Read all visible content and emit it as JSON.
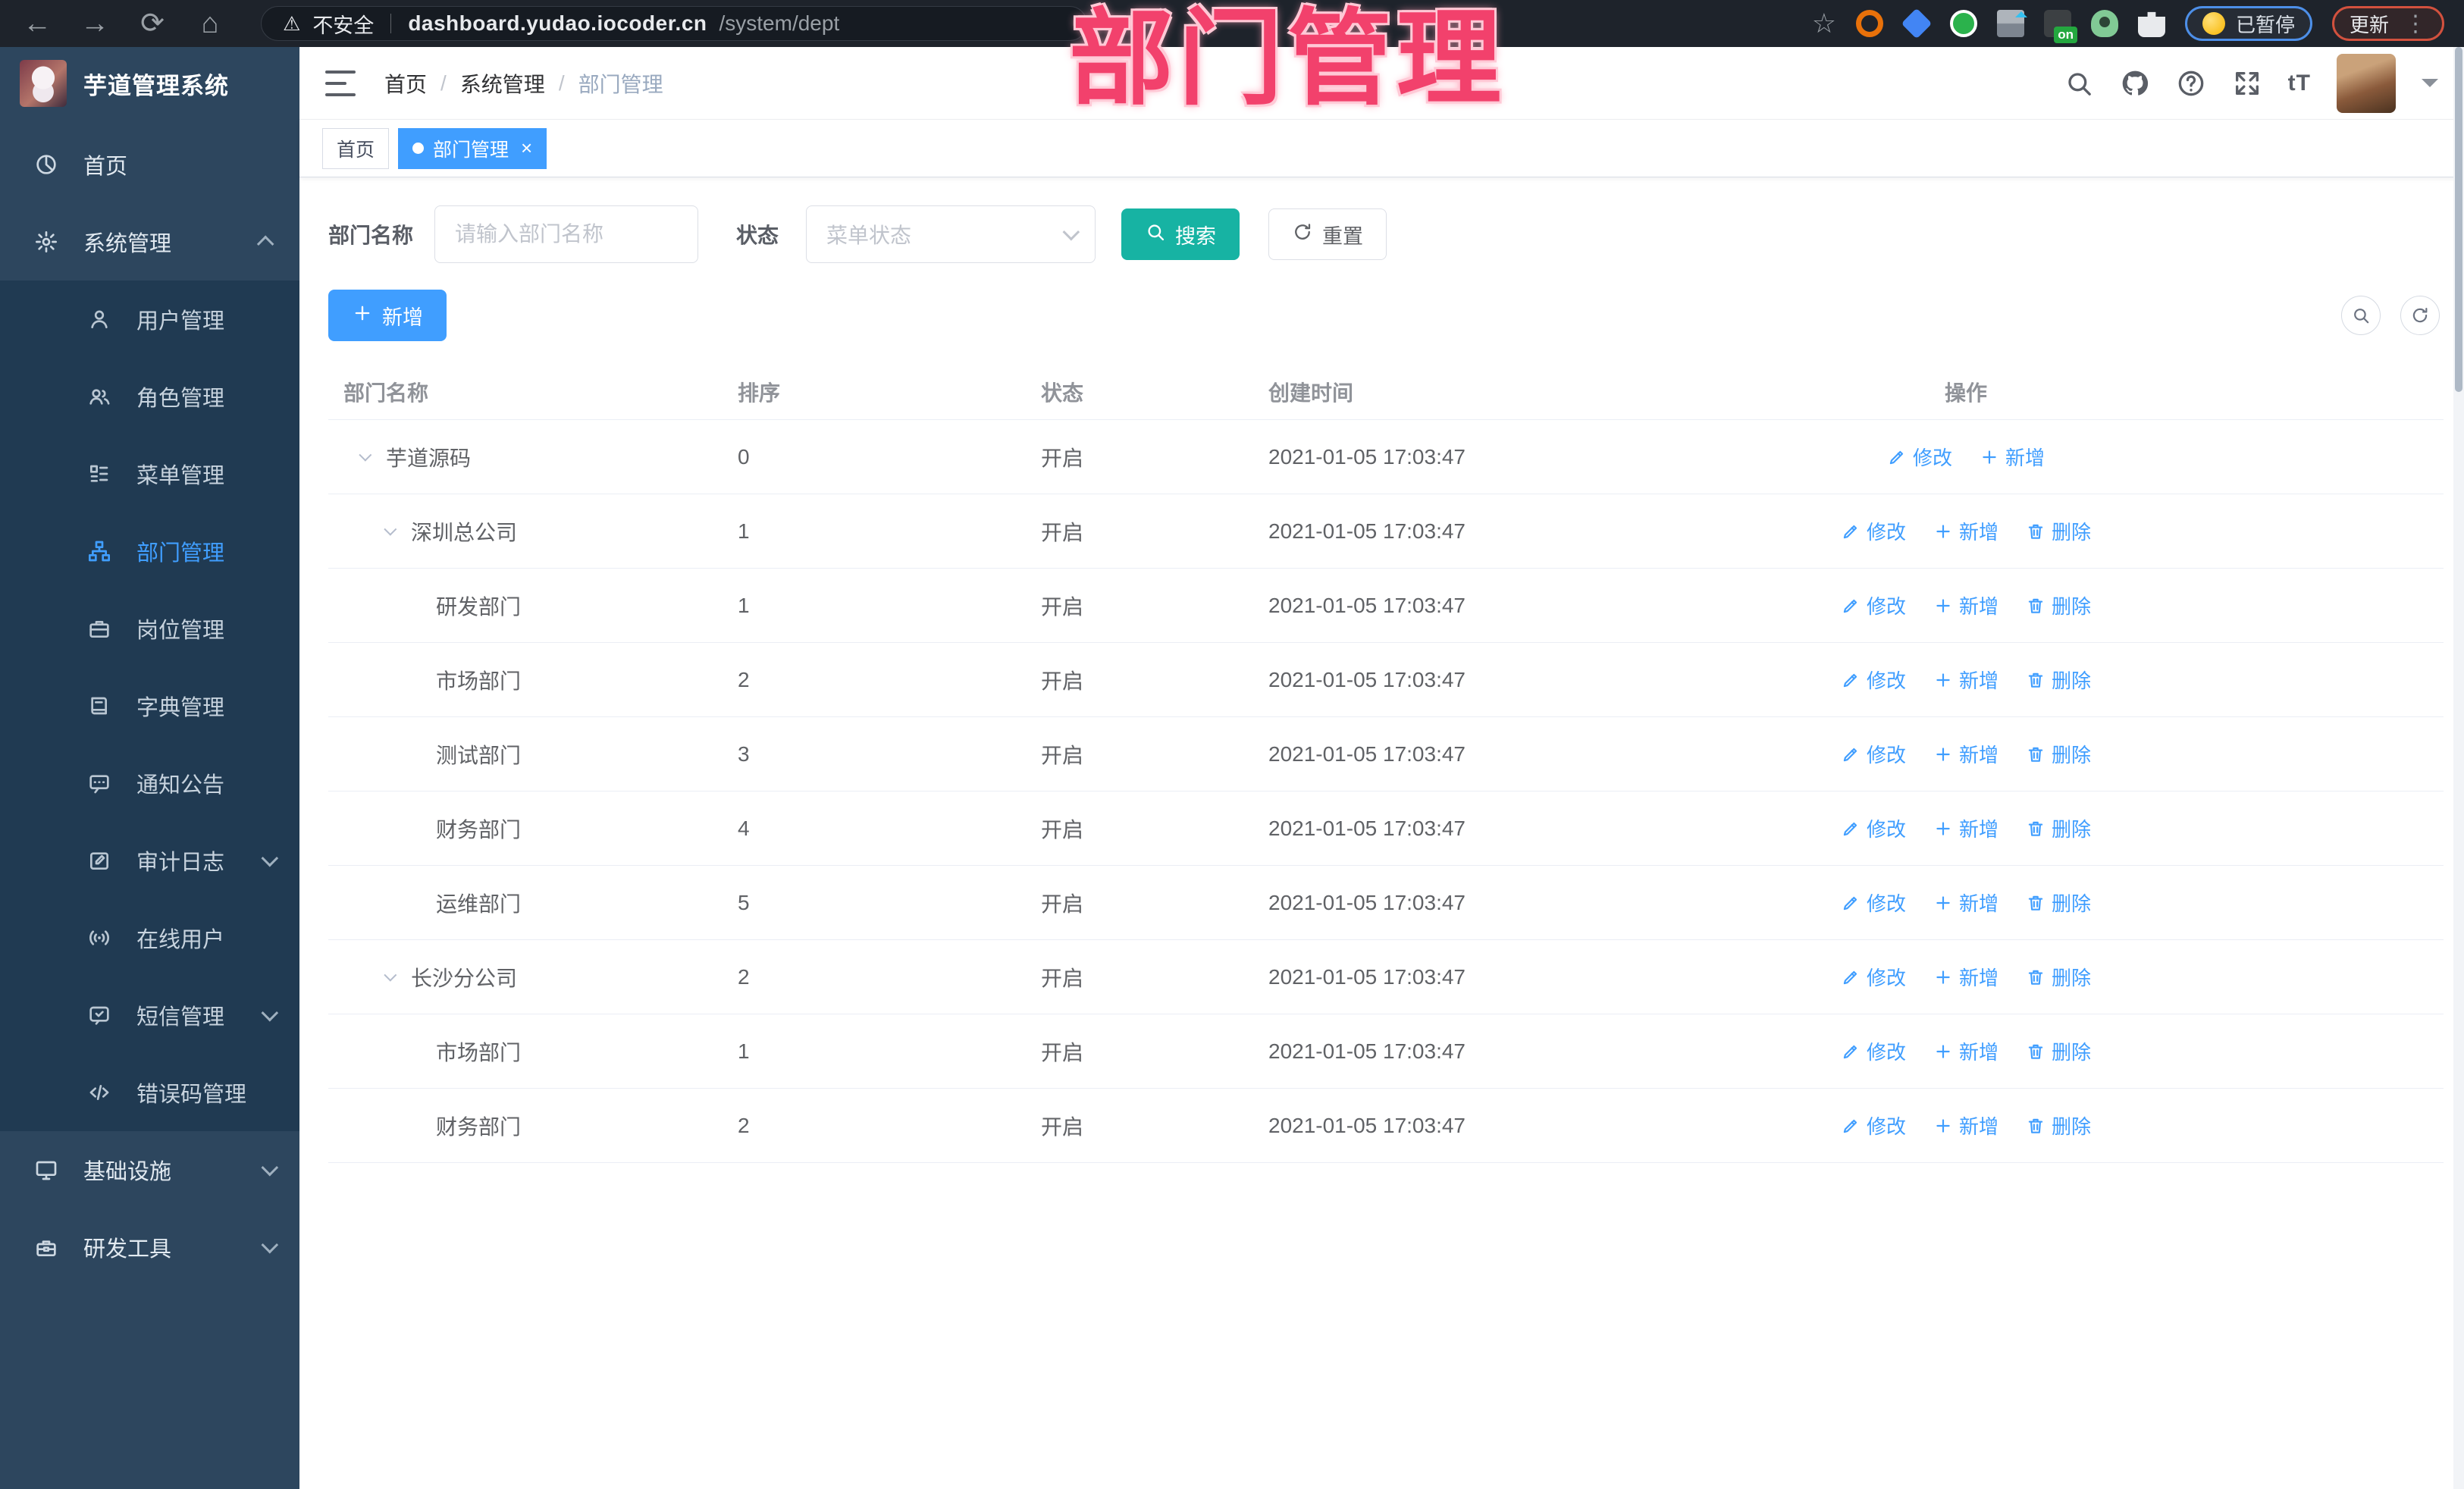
{
  "browser": {
    "security_label": "不安全",
    "url_host": "dashboard.yudao.iocoder.cn",
    "url_path": "/system/dept",
    "profile_status": "已暂停",
    "update_label": "更新",
    "menu_dots": "⋮",
    "star": "☆",
    "back": "←",
    "forward": "→",
    "reload": "⟳",
    "home": "⌂",
    "warning": "⚠"
  },
  "overlay_title": "部门管理",
  "header": {
    "app_title": "芋道管理系统",
    "breadcrumb": [
      {
        "label": "首页"
      },
      {
        "label": "系统管理"
      },
      {
        "label": "部门管理",
        "current": true
      }
    ],
    "fontsize_icon_text": "tT"
  },
  "tabs": [
    {
      "label": "首页",
      "active": false
    },
    {
      "label": "部门管理",
      "active": true,
      "closable": true
    }
  ],
  "sidebar": {
    "items": [
      {
        "label": "首页",
        "icon": "dashboard-icon",
        "level": 0
      },
      {
        "label": "系统管理",
        "icon": "gear-icon",
        "level": 0,
        "arrow": "up"
      },
      {
        "label": "用户管理",
        "icon": "user-icon",
        "level": 1
      },
      {
        "label": "角色管理",
        "icon": "users-icon",
        "level": 1
      },
      {
        "label": "菜单管理",
        "icon": "menu-list-icon",
        "level": 1
      },
      {
        "label": "部门管理",
        "icon": "org-tree-icon",
        "level": 1,
        "active": true
      },
      {
        "label": "岗位管理",
        "icon": "briefcase-icon",
        "level": 1
      },
      {
        "label": "字典管理",
        "icon": "book-icon",
        "level": 1
      },
      {
        "label": "通知公告",
        "icon": "megaphone-icon",
        "level": 1
      },
      {
        "label": "审计日志",
        "icon": "audit-log-icon",
        "level": 1,
        "arrow": "down"
      },
      {
        "label": "在线用户",
        "icon": "online-icon",
        "level": 1
      },
      {
        "label": "短信管理",
        "icon": "sms-icon",
        "level": 1,
        "arrow": "down"
      },
      {
        "label": "错误码管理",
        "icon": "code-icon",
        "level": 1
      },
      {
        "label": "基础设施",
        "icon": "monitor-icon",
        "level": 0,
        "arrow": "down"
      },
      {
        "label": "研发工具",
        "icon": "toolbox-icon",
        "level": 0,
        "arrow": "down"
      }
    ]
  },
  "filters": {
    "dept_name_label": "部门名称",
    "dept_name_placeholder": "请输入部门名称",
    "dept_name_value": "",
    "status_label": "状态",
    "status_placeholder": "菜单状态",
    "search_label": "搜索",
    "reset_label": "重置"
  },
  "toolbar": {
    "add_label": "新增"
  },
  "table": {
    "columns": [
      "部门名称",
      "排序",
      "状态",
      "创建时间",
      "操作"
    ],
    "rows": [
      {
        "name": "芋道源码",
        "level": 0,
        "expandable": true,
        "sort": "0",
        "status": "开启",
        "created": "2021-01-05 17:03:47",
        "actions": [
          {
            "type": "edit",
            "label": "修改"
          },
          {
            "type": "add",
            "label": "新增"
          }
        ]
      },
      {
        "name": "深圳总公司",
        "level": 1,
        "expandable": true,
        "sort": "1",
        "status": "开启",
        "created": "2021-01-05 17:03:47",
        "actions": [
          {
            "type": "edit",
            "label": "修改"
          },
          {
            "type": "add",
            "label": "新增"
          },
          {
            "type": "delete",
            "label": "删除"
          }
        ]
      },
      {
        "name": "研发部门",
        "level": 2,
        "expandable": false,
        "sort": "1",
        "status": "开启",
        "created": "2021-01-05 17:03:47",
        "actions": [
          {
            "type": "edit",
            "label": "修改"
          },
          {
            "type": "add",
            "label": "新增"
          },
          {
            "type": "delete",
            "label": "删除"
          }
        ]
      },
      {
        "name": "市场部门",
        "level": 2,
        "expandable": false,
        "sort": "2",
        "status": "开启",
        "created": "2021-01-05 17:03:47",
        "actions": [
          {
            "type": "edit",
            "label": "修改"
          },
          {
            "type": "add",
            "label": "新增"
          },
          {
            "type": "delete",
            "label": "删除"
          }
        ]
      },
      {
        "name": "测试部门",
        "level": 2,
        "expandable": false,
        "sort": "3",
        "status": "开启",
        "created": "2021-01-05 17:03:47",
        "actions": [
          {
            "type": "edit",
            "label": "修改"
          },
          {
            "type": "add",
            "label": "新增"
          },
          {
            "type": "delete",
            "label": "删除"
          }
        ]
      },
      {
        "name": "财务部门",
        "level": 2,
        "expandable": false,
        "sort": "4",
        "status": "开启",
        "created": "2021-01-05 17:03:47",
        "actions": [
          {
            "type": "edit",
            "label": "修改"
          },
          {
            "type": "add",
            "label": "新增"
          },
          {
            "type": "delete",
            "label": "删除"
          }
        ]
      },
      {
        "name": "运维部门",
        "level": 2,
        "expandable": false,
        "sort": "5",
        "status": "开启",
        "created": "2021-01-05 17:03:47",
        "actions": [
          {
            "type": "edit",
            "label": "修改"
          },
          {
            "type": "add",
            "label": "新增"
          },
          {
            "type": "delete",
            "label": "删除"
          }
        ]
      },
      {
        "name": "长沙分公司",
        "level": 1,
        "expandable": true,
        "sort": "2",
        "status": "开启",
        "created": "2021-01-05 17:03:47",
        "actions": [
          {
            "type": "edit",
            "label": "修改"
          },
          {
            "type": "add",
            "label": "新增"
          },
          {
            "type": "delete",
            "label": "删除"
          }
        ]
      },
      {
        "name": "市场部门",
        "level": 2,
        "expandable": false,
        "sort": "1",
        "status": "开启",
        "created": "2021-01-05 17:03:47",
        "actions": [
          {
            "type": "edit",
            "label": "修改"
          },
          {
            "type": "add",
            "label": "新增"
          },
          {
            "type": "delete",
            "label": "删除"
          }
        ]
      },
      {
        "name": "财务部门",
        "level": 2,
        "expandable": false,
        "sort": "2",
        "status": "开启",
        "created": "2021-01-05 17:03:47",
        "actions": [
          {
            "type": "edit",
            "label": "修改"
          },
          {
            "type": "add",
            "label": "新增"
          },
          {
            "type": "delete",
            "label": "删除"
          }
        ]
      }
    ]
  },
  "colors": {
    "accent": "#409eff",
    "search_button": "#17b3a3",
    "sidebar_bg": "#2d465e",
    "submenu_bg": "#203a52",
    "overlay": "#f2416c"
  }
}
